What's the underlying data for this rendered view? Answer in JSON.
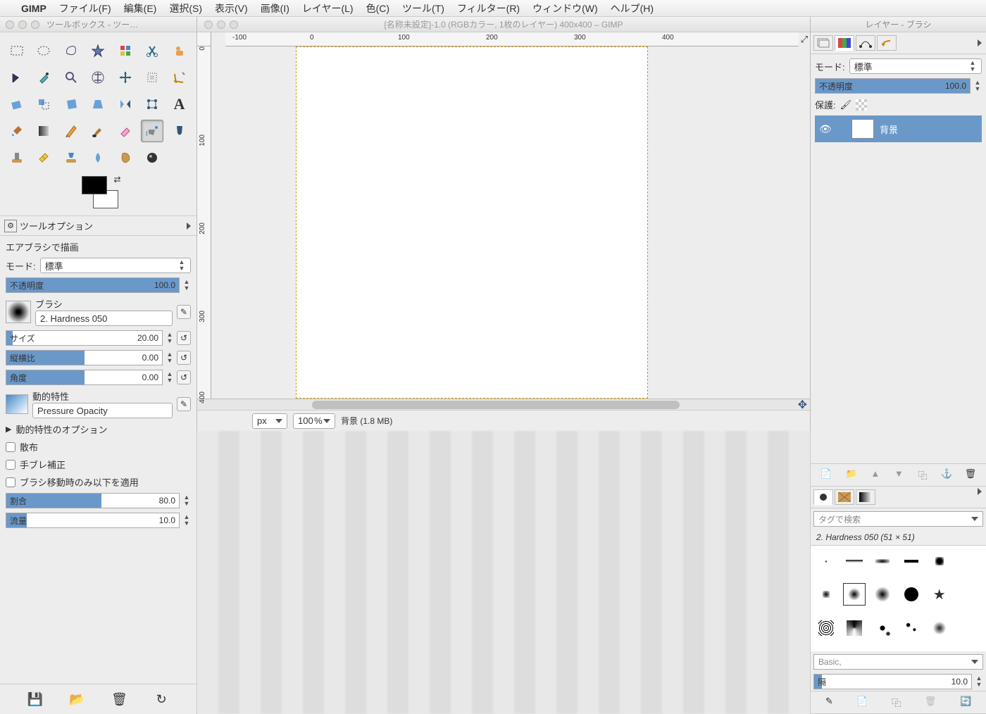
{
  "menubar": {
    "app": "GIMP",
    "items": [
      "ファイル(F)",
      "編集(E)",
      "選択(S)",
      "表示(V)",
      "画像(I)",
      "レイヤー(L)",
      "色(C)",
      "ツール(T)",
      "フィルター(R)",
      "ウィンドウ(W)",
      "ヘルプ(H)"
    ]
  },
  "toolbox": {
    "title": "ツールボックス - ツー…",
    "options_tab": "ツールオプション",
    "paint_with": "エアブラシで描画",
    "mode_label": "モード:",
    "mode_value": "標準",
    "opacity_label": "不透明度",
    "opacity_value": "100.0",
    "brush_label": "ブラシ",
    "brush_name": "2. Hardness 050",
    "size_label": "サイズ",
    "size_value": "20.00",
    "aspect_label": "縦横比",
    "aspect_value": "0.00",
    "angle_label": "角度",
    "angle_value": "0.00",
    "dynamics_label": "動的特性",
    "dynamics_value": "Pressure Opacity",
    "dynamics_options": "動的特性のオプション",
    "scatter": "散布",
    "jitter": "手ブレ補正",
    "apply_on_move": "ブラシ移動時のみ以下を適用",
    "rate_label": "割合",
    "rate_value": "80.0",
    "flow_label": "流量",
    "flow_value": "10.0"
  },
  "canvas": {
    "title": "[名称未設定]-1.0 (RGBカラー, 1枚のレイヤー) 400x400 – GIMP",
    "ruler_marks_h": [
      "-100",
      "0",
      "100",
      "200",
      "300",
      "400"
    ],
    "ruler_marks_v": [
      "0",
      "100",
      "200",
      "300",
      "400"
    ],
    "unit": "px",
    "zoom": "100",
    "zoom_pct": "%",
    "status": "背景 (1.8 MB)"
  },
  "layers": {
    "title": "レイヤー - ブラシ",
    "mode_label": "モード:",
    "mode_value": "標準",
    "opacity_label": "不透明度",
    "opacity_value": "100.0",
    "lock_label": "保護:",
    "layer_name": "背景"
  },
  "brushes": {
    "search_placeholder": "タグで検索",
    "current": "2. Hardness 050 (51 × 51)",
    "collection": "Basic,",
    "spacing_label": "隔",
    "spacing_value": "10.0"
  }
}
